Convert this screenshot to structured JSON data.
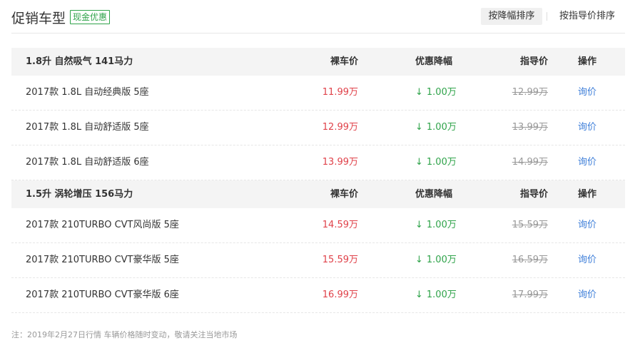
{
  "header": {
    "title": "促销车型",
    "badge": "现金优惠",
    "sort_discount": "按降幅排序",
    "sort_guide": "按指导价排序"
  },
  "columns": {
    "price": "裸车价",
    "discount": "优惠降幅",
    "guide": "指导价",
    "action": "操作"
  },
  "groups": [
    {
      "name": "1.8升 自然吸气 141马力",
      "rows": [
        {
          "model": "2017款 1.8L 自动经典版 5座",
          "price": "11.99万",
          "discount": "1.00万",
          "guide": "12.99万",
          "action": "询价"
        },
        {
          "model": "2017款 1.8L 自动舒适版 5座",
          "price": "12.99万",
          "discount": "1.00万",
          "guide": "13.99万",
          "action": "询价"
        },
        {
          "model": "2017款 1.8L 自动舒适版 6座",
          "price": "13.99万",
          "discount": "1.00万",
          "guide": "14.99万",
          "action": "询价"
        }
      ]
    },
    {
      "name": "1.5升 涡轮增压 156马力",
      "rows": [
        {
          "model": "2017款 210TURBO CVT风尚版 5座",
          "price": "14.59万",
          "discount": "1.00万",
          "guide": "15.59万",
          "action": "询价"
        },
        {
          "model": "2017款 210TURBO CVT豪华版 5座",
          "price": "15.59万",
          "discount": "1.00万",
          "guide": "16.59万",
          "action": "询价"
        },
        {
          "model": "2017款 210TURBO CVT豪华版 6座",
          "price": "16.99万",
          "discount": "1.00万",
          "guide": "17.99万",
          "action": "询价"
        }
      ]
    }
  ],
  "icons": {
    "discount_arrow": "down-arrow-icon",
    "arrow_glyph": "↓"
  },
  "colors": {
    "price": "#e0424a",
    "discount": "#2fa34a",
    "link": "#3f7fd9",
    "badge": "#2fa34a"
  },
  "note": "注：2019年2月27日行情 车辆价格随时变动，敬请关注当地市场"
}
